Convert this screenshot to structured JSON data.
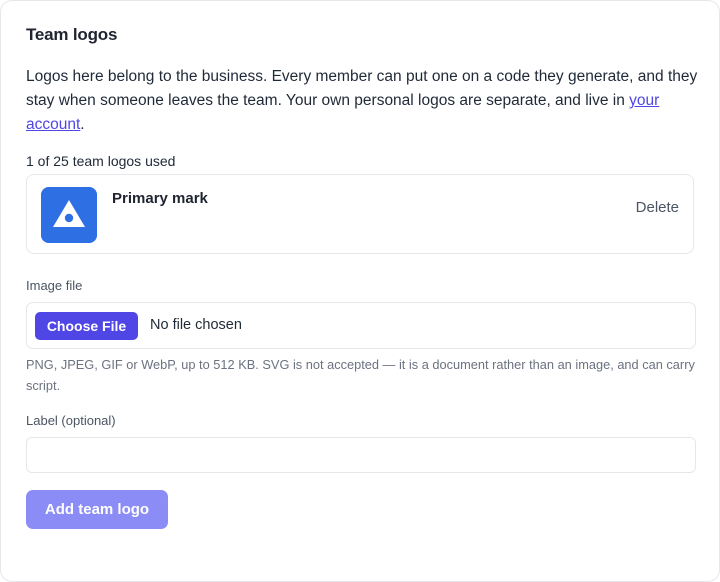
{
  "section": {
    "title": "Team logos",
    "description_text": "Logos here belong to the business. Every member can put one on a code they generate, and they stay when someone leaves the team. Your own personal logos are separate, and live in ",
    "description_link": "your account",
    "description_end": "."
  },
  "usage": {
    "text": "1 of 25 team logos used",
    "used": 1,
    "limit": 25
  },
  "logos": [
    {
      "name": "Primary mark",
      "delete_label": "Delete",
      "thumb_color": "#2f6fe4",
      "icon": "triangle-logo-icon"
    }
  ],
  "image_field": {
    "label": "Image file",
    "button_label": "Choose File",
    "status": "No file chosen",
    "help": "PNG, JPEG, GIF or WebP, up to 512 KB. SVG is not accepted — it is a document rather than an image, and can carry script."
  },
  "label_field": {
    "label": "Label (optional)",
    "value": "",
    "placeholder": ""
  },
  "submit": {
    "label": "Add team logo",
    "enabled": false
  },
  "colors": {
    "accent": "#4f46e5",
    "accent_disabled": "#8b8cf5",
    "border": "#e5e7eb"
  }
}
